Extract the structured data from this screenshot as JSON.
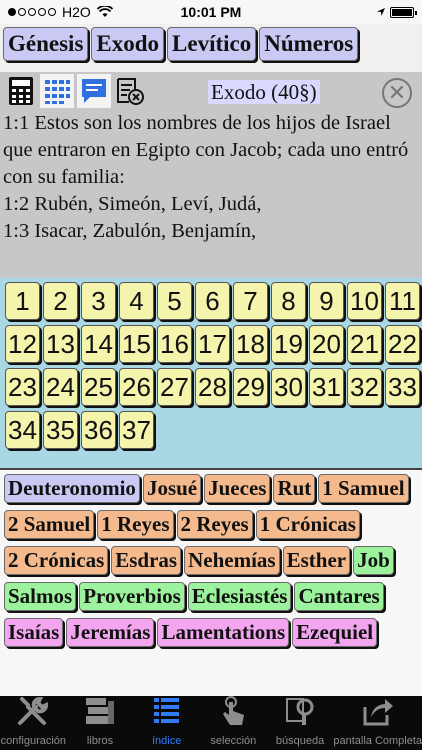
{
  "status": {
    "carrier": "H2O",
    "time": "10:01 PM"
  },
  "top_books": [
    "Génesis",
    "Exodo",
    "Levítico",
    "Números"
  ],
  "reader": {
    "title": "Exodo (40§)",
    "verses": [
      "1:1  Estos son los nombres de los hijos de Israel que entraron en Egipto con Jacob; cada uno entró con su familia:",
      "1:2  Rubén, Simeón, Leví, Judá,",
      "1:3  Isacar, Zabulón, Benjamín,"
    ]
  },
  "chapters": [
    "1",
    "2",
    "3",
    "4",
    "5",
    "6",
    "7",
    "8",
    "9",
    "10",
    "11",
    "12",
    "13",
    "14",
    "15",
    "16",
    "17",
    "18",
    "19",
    "20",
    "21",
    "22",
    "23",
    "24",
    "25",
    "26",
    "27",
    "28",
    "29",
    "30",
    "31",
    "32",
    "33",
    "34",
    "35",
    "36",
    "37"
  ],
  "books": [
    {
      "label": "Deuteronomio",
      "color": "#c9c9f3"
    },
    {
      "label": "Josué",
      "color": "#f4b98c"
    },
    {
      "label": "Jueces",
      "color": "#f4b98c"
    },
    {
      "label": "Rut",
      "color": "#f4b98c"
    },
    {
      "label": "1 Samuel",
      "color": "#f4b98c"
    },
    {
      "label": "2 Samuel",
      "color": "#f4b98c"
    },
    {
      "label": "1 Reyes",
      "color": "#f4b98c"
    },
    {
      "label": "2 Reyes",
      "color": "#f4b98c"
    },
    {
      "label": "1 Crónicas",
      "color": "#f4b98c"
    },
    {
      "label": "2 Crónicas",
      "color": "#f4b98c"
    },
    {
      "label": "Esdras",
      "color": "#f4b98c"
    },
    {
      "label": "Nehemías",
      "color": "#f4b98c"
    },
    {
      "label": "Esther",
      "color": "#f4b98c"
    },
    {
      "label": "Job",
      "color": "#9df39d"
    },
    {
      "label": "Salmos",
      "color": "#9df39d"
    },
    {
      "label": "Proverbios",
      "color": "#9df39d"
    },
    {
      "label": "Eclesiastés",
      "color": "#9df39d"
    },
    {
      "label": "Cantares",
      "color": "#9df39d"
    },
    {
      "label": "Isaías",
      "color": "#f3a6ef"
    },
    {
      "label": "Jeremías",
      "color": "#f3a6ef"
    },
    {
      "label": "Lamentations",
      "color": "#f3a6ef"
    },
    {
      "label": "Ezequiel",
      "color": "#f3a6ef"
    }
  ],
  "tabs": [
    {
      "label": "configuración",
      "icon": "tools-icon",
      "active": false
    },
    {
      "label": "libros",
      "icon": "books-icon",
      "active": false
    },
    {
      "label": "índice",
      "icon": "index-list-icon",
      "active": true
    },
    {
      "label": "selección",
      "icon": "tap-hand-icon",
      "active": false
    },
    {
      "label": "búsqueda",
      "icon": "search-document-icon",
      "active": false
    },
    {
      "label": "pantalla Completa",
      "icon": "share-icon",
      "active": false
    }
  ],
  "colors": {
    "accent": "#2f7cf6",
    "chapter_bg": "#a9d7e4",
    "chapter_btn": "#f4f4ad"
  }
}
